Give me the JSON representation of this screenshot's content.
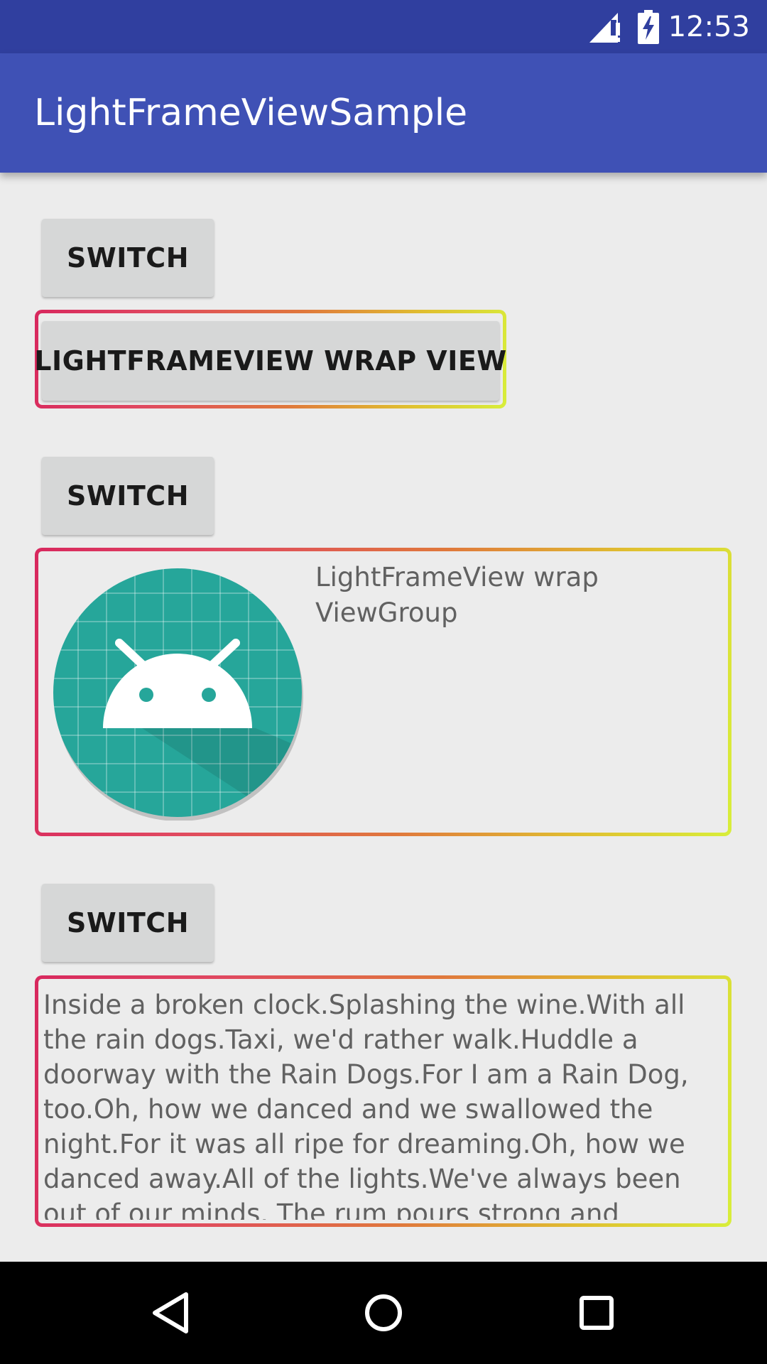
{
  "status_bar": {
    "time": "12:53",
    "icons": [
      "signal-no-data-icon",
      "battery-charging-icon"
    ],
    "color": "#303f9f"
  },
  "app_bar": {
    "title": "LightFrameViewSample",
    "color": "#3f51b5"
  },
  "sections": [
    {
      "switch_label": "SWITCH",
      "content_button_label": "LIGHTFRAMEVIEW WRAP VIEW"
    },
    {
      "switch_label": "SWITCH",
      "image_icon": "android-launcher-icon",
      "text": "LightFrameView wrap ViewGroup"
    },
    {
      "switch_label": "SWITCH",
      "text": "Inside a broken clock.Splashing the wine.With all the rain dogs.Taxi, we'd rather walk.Huddle a doorway with the Rain Dogs.For I am a Rain Dog, too.Oh, how we danced and we swallowed the night.For it was all ripe for dreaming.Oh, how we danced away.All of the lights.We've always been out of our minds. The rum pours strong and"
    }
  ],
  "frame_gradient": [
    "#d8285e",
    "#e04860",
    "#e0783c",
    "#e0c030",
    "#d8ee3a"
  ],
  "nav_bar": {
    "icons": [
      "back-icon",
      "home-icon",
      "recents-icon"
    ]
  }
}
